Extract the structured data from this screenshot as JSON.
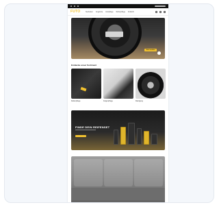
{
  "header": {
    "logo_text": "FUTO",
    "nav": [
      "Neuheiten",
      "Angebote",
      "Autopflege",
      "Reifenpflege",
      "Zubehör"
    ]
  },
  "section": {
    "title": "Entdecke unser Sortiment",
    "tiles": [
      {
        "label": "Reifenpflege",
        "icon": "tire-dressing-image"
      },
      {
        "label": "Felgenpflege",
        "icon": "wheel-cleaning-image"
      },
      {
        "label": "Reinigung",
        "icon": "rim-image"
      }
    ]
  },
  "hero": {
    "cta_label": "Jetzt ansehen"
  },
  "banner": {
    "title": "FINDE DEIN REIFENSET"
  },
  "colors": {
    "accent": "#f2c230",
    "dark": "#111111"
  }
}
